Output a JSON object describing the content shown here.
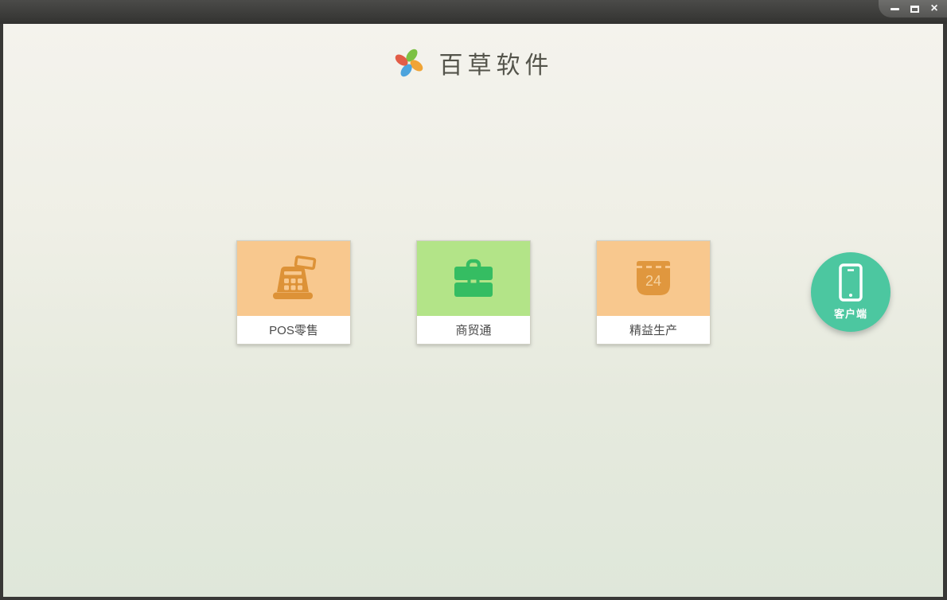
{
  "window": {
    "controls": {
      "minimize_icon": "–",
      "maximize_icon": "□",
      "close_icon": "×"
    },
    "titlebar_color": "#3c3c3a"
  },
  "header": {
    "app_title": "百草软件",
    "logo": {
      "name": "pinwheel-logo",
      "petal_colors": [
        "#7cc144",
        "#f0a435",
        "#4da4dd",
        "#e25d47"
      ]
    }
  },
  "products": [
    {
      "label": "POS零售",
      "icon": "cash-register-icon",
      "tile_color": "#f8c88e",
      "icon_color": "#dd9237"
    },
    {
      "label": "商贸通",
      "icon": "briefcase-icon",
      "tile_color": "#b3e488",
      "icon_color": "#35bd62"
    },
    {
      "label": "精益生产",
      "icon": "calendar-icon",
      "tile_color": "#f8c88e",
      "icon_color": "#e0973e",
      "calendar_day": "24"
    }
  ],
  "client_button": {
    "label": "客户端",
    "icon": "smartphone-icon",
    "color": "#4cc7a0"
  },
  "background": {
    "top_color": "#f4f3ed",
    "bottom_color": "#dfe7da",
    "frame_color": "#383836"
  }
}
